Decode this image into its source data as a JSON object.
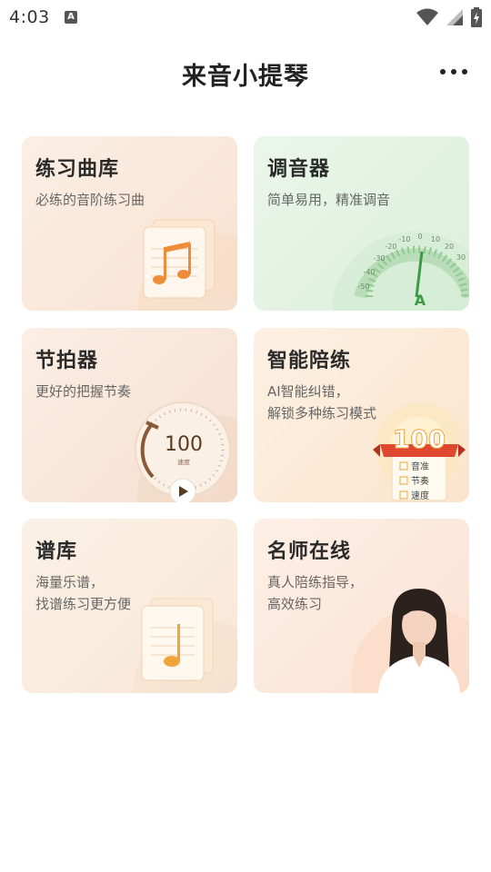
{
  "status_bar": {
    "time": "4:03",
    "notification_icon": "a-icon",
    "icons": [
      "wifi-icon",
      "signal-icon",
      "battery-charging-icon"
    ]
  },
  "header": {
    "title": "来音小提琴",
    "more_icon": "more-icon"
  },
  "cards": {
    "practice": {
      "title": "练习曲库",
      "desc": "必练的音阶练习曲",
      "icon": "music-notes-icon"
    },
    "tuner": {
      "title": "调音器",
      "desc": "简单易用，精准调音",
      "icon": "tuner-dial-icon",
      "scale_labels": [
        "-50",
        "-40",
        "-30",
        "-20",
        "-10",
        "0",
        "10",
        "20",
        "30"
      ],
      "note": "A"
    },
    "metronome": {
      "title": "节拍器",
      "desc": "更好的把握节奏",
      "icon": "metronome-dial-icon",
      "tempo": "100",
      "tempo_label": "速度"
    },
    "ai": {
      "title": "智能陪练",
      "desc": "AI智能纠错，\n解锁多种练习模式",
      "icon": "score-badge-icon",
      "score": "100",
      "checklist": [
        "音准",
        "节奏",
        "速度"
      ]
    },
    "scores": {
      "title": "谱库",
      "desc": "海量乐谱，\n找谱练习更方便",
      "icon": "sheet-music-icon"
    },
    "teacher": {
      "title": "名师在线",
      "desc": "真人陪练指导，\n高效练习",
      "icon": "teacher-portrait"
    }
  },
  "colors": {
    "accent_orange": "#f2a33a",
    "tuner_green": "#59b35f",
    "badge_red": "#e0472f"
  }
}
